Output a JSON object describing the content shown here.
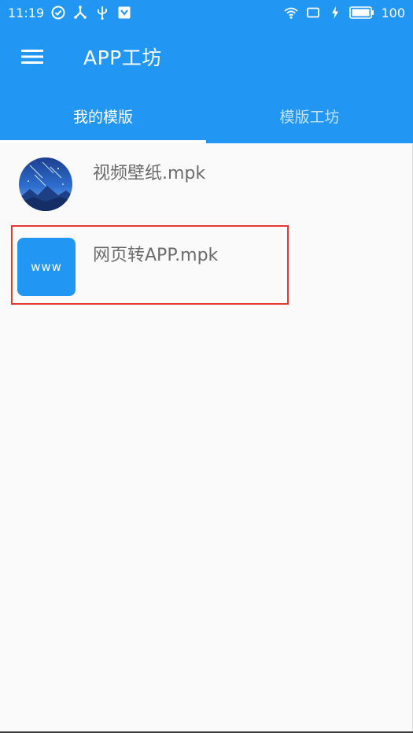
{
  "status_bar": {
    "time": "11:19",
    "battery_level": "100",
    "left_icons": [
      "check-circle-icon",
      "usb-branch-icon",
      "usb-icon",
      "shield-download-icon"
    ],
    "right_icons": [
      "wifi-icon",
      "screen-icon",
      "charging-bolt-icon",
      "battery-icon"
    ]
  },
  "app_bar": {
    "title": "APP工坊",
    "menu_icon": "hamburger-menu-icon"
  },
  "tabs": [
    {
      "label": "我的模版",
      "active": true
    },
    {
      "label": "模版工坊",
      "active": false
    }
  ],
  "list": {
    "items": [
      {
        "label": "视频壁纸.mpk",
        "icon": "starry-night-icon"
      },
      {
        "label": "网页转APP.mpk",
        "icon": "www-icon",
        "icon_text": "www"
      }
    ]
  },
  "colors": {
    "primary": "#2196f3",
    "background": "#fafafa",
    "item_text": "#6b6b6b",
    "highlight": "#e53935"
  }
}
